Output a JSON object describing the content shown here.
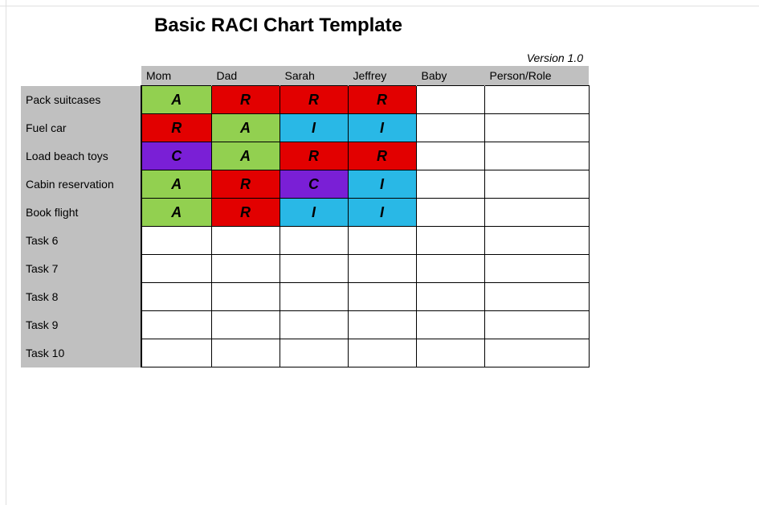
{
  "title": "Basic RACI Chart Template",
  "version": "Version 1.0",
  "columns": [
    "Mom",
    "Dad",
    "Sarah",
    "Jeffrey",
    "Baby",
    "Person/Role"
  ],
  "rows": [
    {
      "label": "Pack suitcases",
      "cells": [
        "A",
        "R",
        "R",
        "R",
        "",
        ""
      ]
    },
    {
      "label": "Fuel car",
      "cells": [
        "R",
        "A",
        "I",
        "I",
        "",
        ""
      ]
    },
    {
      "label": "Load beach toys",
      "cells": [
        "C",
        "A",
        "R",
        "R",
        "",
        ""
      ]
    },
    {
      "label": "Cabin reservation",
      "cells": [
        "A",
        "R",
        "C",
        "I",
        "",
        ""
      ]
    },
    {
      "label": "Book flight",
      "cells": [
        "A",
        "R",
        "I",
        "I",
        "",
        ""
      ]
    },
    {
      "label": "Task 6",
      "cells": [
        "",
        "",
        "",
        "",
        "",
        ""
      ]
    },
    {
      "label": "Task 7",
      "cells": [
        "",
        "",
        "",
        "",
        "",
        ""
      ]
    },
    {
      "label": "Task 8",
      "cells": [
        "",
        "",
        "",
        "",
        "",
        ""
      ]
    },
    {
      "label": "Task 9",
      "cells": [
        "",
        "",
        "",
        "",
        "",
        ""
      ]
    },
    {
      "label": "Task 10",
      "cells": [
        "",
        "",
        "",
        "",
        "",
        ""
      ]
    }
  ],
  "raci_colors": {
    "A": "#92d050",
    "R": "#e20000",
    "C": "#7a1fd6",
    "I": "#29b8e6"
  }
}
